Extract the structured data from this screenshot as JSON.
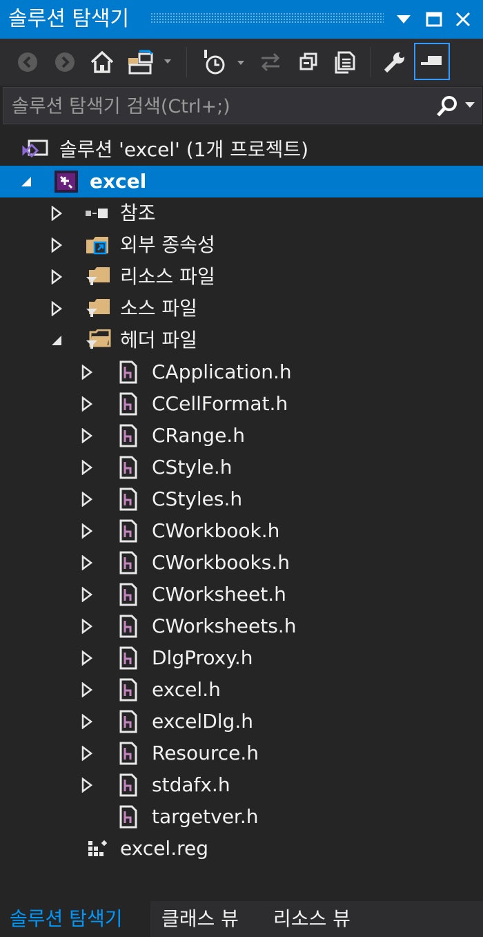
{
  "window": {
    "title": "솔루션 탐색기",
    "accent": "#007acc",
    "controls": [
      "chevron-down-icon",
      "maximize-icon",
      "close-icon"
    ]
  },
  "toolbar": {
    "buttons": [
      "back-icon",
      "forward-icon",
      "home-icon",
      "switch-views-icon",
      "pending-changes-filter-icon",
      "sync-icon",
      "collapse-all-icon",
      "show-all-files-icon",
      "properties-icon",
      "preview-selected-icon"
    ]
  },
  "search": {
    "placeholder": "솔루션 탐색기 검색(Ctrl+;)"
  },
  "tree": {
    "solution": "솔루션 'excel' (1개 프로젝트)",
    "project": "excel",
    "references": "참조",
    "external": "외부 종속성",
    "resources": "리소스 파일",
    "sources": "소스 파일",
    "headers": "헤더 파일",
    "header_files": [
      "CApplication.h",
      "CCellFormat.h",
      "CRange.h",
      "CStyle.h",
      "CStyles.h",
      "CWorkbook.h",
      "CWorkbooks.h",
      "CWorksheet.h",
      "CWorksheets.h",
      "DlgProxy.h",
      "excel.h",
      "excelDlg.h",
      "Resource.h",
      "stdafx.h",
      "targetver.h"
    ],
    "reg_file": "excel.reg"
  },
  "tabs": [
    "솔루션 탐색기",
    "클래스 뷰",
    "리소스 뷰"
  ]
}
